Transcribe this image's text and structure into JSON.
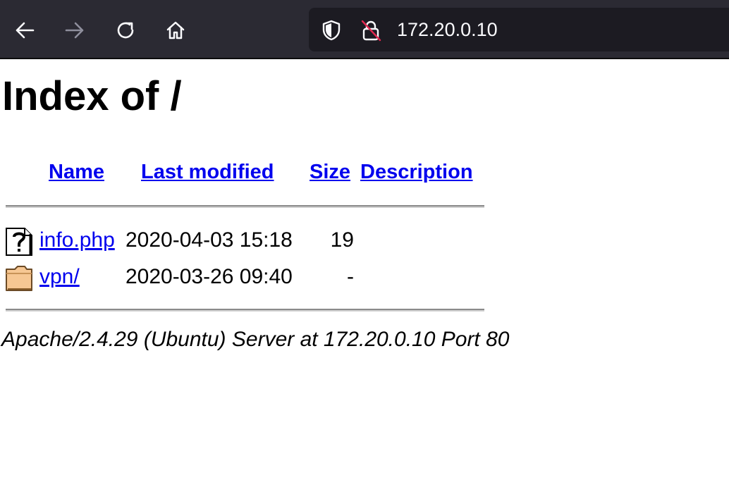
{
  "browser": {
    "url": "172.20.0.10",
    "icons": {
      "back": "back-arrow-icon",
      "forward": "forward-arrow-icon",
      "reload": "reload-icon",
      "home": "home-icon",
      "tracking": "shield-icon",
      "insecure": "insecure-lock-icon"
    }
  },
  "page": {
    "title": "Index of /",
    "columns": {
      "name": "Name",
      "last_modified": "Last modified",
      "size": "Size",
      "description": "Description"
    },
    "entries": [
      {
        "name": "info.php",
        "last_modified": "2020-04-03 15:18",
        "size": "19",
        "description": "",
        "icon": "unknown-file-icon"
      },
      {
        "name": "vpn/",
        "last_modified": "2020-03-26 09:40",
        "size": "-",
        "description": "",
        "icon": "folder-icon"
      }
    ],
    "footer": "Apache/2.4.29 (Ubuntu) Server at 172.20.0.10 Port 80"
  },
  "colors": {
    "toolbar_bg": "#2b2a33",
    "urlbar_bg": "#1c1b22",
    "link": "#0000ee"
  }
}
